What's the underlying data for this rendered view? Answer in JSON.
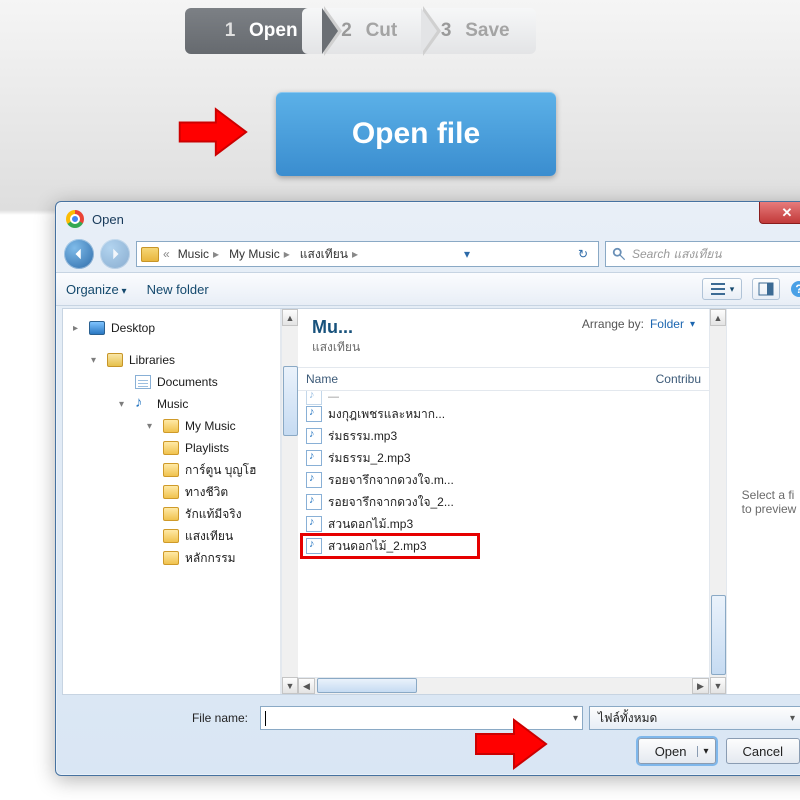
{
  "page": {
    "steps": [
      {
        "num": "1",
        "label": "Open",
        "active": true
      },
      {
        "num": "2",
        "label": "Cut",
        "active": false
      },
      {
        "num": "3",
        "label": "Save",
        "active": false
      }
    ],
    "open_file_button": "Open file"
  },
  "dialog": {
    "title": "Open",
    "nav": {
      "crumb_prefix": "«",
      "crumbs": [
        "Music",
        "My Music",
        "แสงเทียน"
      ],
      "search_placeholder": "Search แสงเทียน"
    },
    "toolbar": {
      "organize": "Organize",
      "new_folder": "New folder"
    },
    "tree": [
      {
        "label": "Desktop",
        "icon": "desktop",
        "level": 0
      },
      {
        "label": "Libraries",
        "icon": "lib",
        "level": 1,
        "expanded": true
      },
      {
        "label": "Documents",
        "icon": "doc",
        "level": 2
      },
      {
        "label": "Music",
        "icon": "music",
        "level": 2,
        "expanded": true
      },
      {
        "label": "My Music",
        "icon": "fold",
        "level": 3,
        "expanded": true
      },
      {
        "label": "Playlists",
        "icon": "fold",
        "level": 3
      },
      {
        "label": "การ์ตูน บุญโฮ",
        "icon": "fold",
        "level": 3
      },
      {
        "label": "ทางชีวิต",
        "icon": "fold",
        "level": 3
      },
      {
        "label": "รักแท้มีจริง",
        "icon": "fold",
        "level": 3
      },
      {
        "label": "แสงเทียน",
        "icon": "fold",
        "level": 3
      },
      {
        "label": "หลักกรรม",
        "icon": "fold",
        "level": 3
      }
    ],
    "list_header": {
      "title": "Mu...",
      "subtitle": "แสงเทียน",
      "arrange_by_label": "Arrange by:",
      "arrange_by_value": "Folder",
      "col_name": "Name",
      "col_contrib": "Contribu"
    },
    "files": [
      "มงกุฎเพชรและหมาก...",
      "ร่มธรรม.mp3",
      "ร่มธรรม_2.mp3",
      "รอยจารึกจากดวงใจ.m...",
      "รอยจารึกจากดวงใจ_2...",
      "สวนดอกไม้.mp3",
      "สวนดอกไม้_2.mp3"
    ],
    "highlight_index": 6,
    "preview_text": "Select a fi\nto preview",
    "footer": {
      "filename_label": "File name:",
      "filename_value": "",
      "type_filter": "ไฟล์ทั้งหมด",
      "open_label": "Open",
      "cancel_label": "Cancel"
    }
  }
}
